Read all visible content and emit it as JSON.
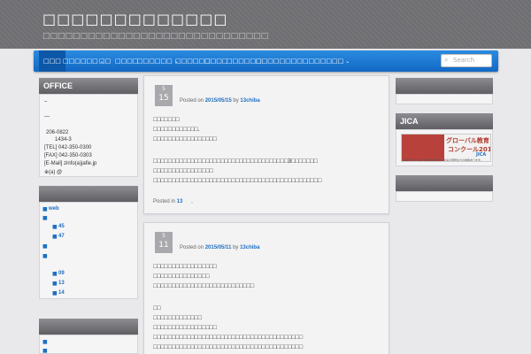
{
  "site": {
    "title": "□□□□□□□□□□□□□",
    "description": "□□□□□□□□□□□□□□□□□□□□□□□□□□□□□□"
  },
  "nav": {
    "items": [
      {
        "label": "□□□"
      },
      {
        "label": "□□□□□□",
        "caret": "⌄"
      },
      {
        "label": "□□"
      },
      {
        "label": "□□□□"
      },
      {
        "label": "□□□□□□",
        "caret": "⌄"
      },
      {
        "label": "□□□□□□"
      },
      {
        "label": "□□□□"
      },
      {
        "label": "□□□□□□"
      },
      {
        "label": "□□□□□□□□□□□□□□□",
        "caret": "⌄"
      }
    ],
    "search_placeholder": "Search",
    "search_icon": "search-icon"
  },
  "left": {
    "office": {
      "title": "OFFICE",
      "lines": [
        "–",
        "—",
        "206-0822",
        "1434-3",
        "[TEL]  042-350-0300",
        "[FAX]  042-350-0303",
        "[E-Mail]  zinfo(a)jafie.jp",
        "※(a)  @"
      ]
    },
    "widget2": {
      "items": [
        {
          "text": "web",
          "link": true,
          "level": 0
        },
        {
          "text": "",
          "level": 0
        },
        {
          "text": "45",
          "link": true,
          "level": 1
        },
        {
          "text": "47",
          "link": true,
          "level": 1
        },
        {
          "text": "",
          "level": 0
        },
        {
          "text": "",
          "level": 0
        },
        {
          "text": "09",
          "link": true,
          "level": 1
        },
        {
          "text": "13",
          "link": true,
          "level": 1
        },
        {
          "text": "14",
          "link": true,
          "level": 1
        }
      ]
    },
    "widget3": {
      "items": [
        "",
        ""
      ]
    }
  },
  "posts": [
    {
      "month": "5",
      "day": "15",
      "posted_on": "Posted on",
      "date": "2015/05/15",
      "by": "by",
      "author": "13chiba",
      "lines": [
        "□□□□□□□",
        "□□□□□□□□□□□□.",
        "□□□□□□□□□□□□□□□□□",
        "",
        "□□□□□□□□□□□□□□□□□□□□□□□□□□□□□□□□□□□□3□□□□□□□",
        "□□□□□□□□□□□□□□□□",
        "□□□□□□□□□□□□□□□□□□□□□□□□□□□□□□□□□□□□□□□□□□□□□"
      ],
      "posted_in": "Posted in",
      "category": "13",
      "sep": ","
    },
    {
      "month": "5",
      "day": "11",
      "posted_on": "Posted on",
      "date": "2015/05/11",
      "by": "by",
      "author": "13chiba",
      "lines": [
        "□□□□□□□□□□□□□□□□□",
        "□□□□□□□□□□□□□□□",
        "□□□□□□□□□□□□□□□□□□□□□□□□□□□",
        "",
        "□□",
        "□□□□□□□□□□□□□",
        "□□□□□□□□□□□□□□□□□",
        "□□□□□□□□□□□□□□□□□□□□□□□□□□□□□□□□□□□□□□□□",
        "□□□□□□□□□□□□□□□□□□□□□□□□□□□□□□□□□□□□□□□□"
      ]
    }
  ],
  "right": {
    "widget1": {
      "title": ""
    },
    "jica": {
      "title": "JICA",
      "banner_title": "グローバル教育",
      "banner_sub": "コンクール2014",
      "banner_logo": "JICA",
      "banner_foot": "海外で輝く仕事、国際協力学学・在品の国際協力の体験あります。"
    },
    "widget3": {
      "title": ""
    }
  }
}
